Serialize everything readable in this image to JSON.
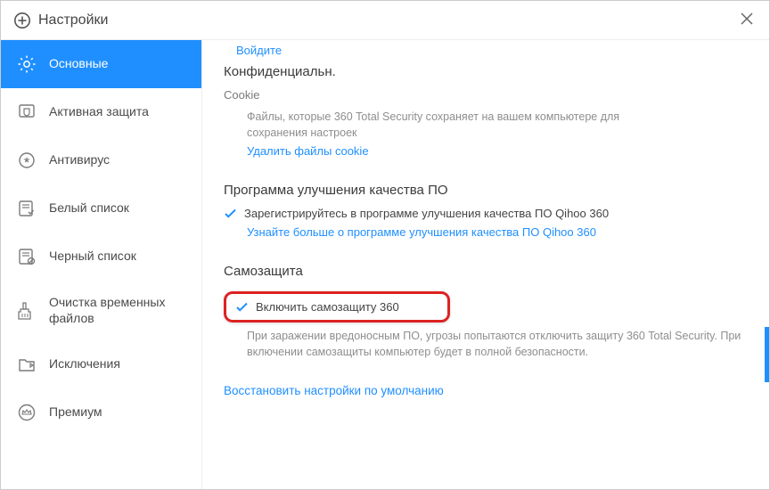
{
  "window": {
    "title": "Настройки"
  },
  "sidebar": {
    "items": [
      {
        "label": "Основные"
      },
      {
        "label": "Активная защита"
      },
      {
        "label": "Антивирус"
      },
      {
        "label": "Белый список"
      },
      {
        "label": "Черный список"
      },
      {
        "label": "Очистка временных файлов"
      },
      {
        "label": "Исключения"
      },
      {
        "label": "Премиум"
      }
    ]
  },
  "content": {
    "login_link": "Войдите",
    "privacy_heading": "Конфиденциальн.",
    "cookie_label": "Cookie",
    "cookie_desc": "Файлы, которые 360 Total Security сохраняет на вашем компьютере для сохранения настроек",
    "cookie_delete_link": "Удалить файлы cookie",
    "improvement_heading": "Программа улучшения качества ПО",
    "improvement_checkbox_label": "Зарегистрируйтесь в программе улучшения качества ПО Qihoo 360",
    "improvement_link": "Узнайте больше о программе улучшения качества ПО Qihoo 360",
    "selfprotect_heading": "Самозащита",
    "selfprotect_checkbox_label": "Включить самозащиту 360",
    "selfprotect_desc": "При заражении вредоносным ПО, угрозы попытаются отключить защиту 360 Total Security. При включении самозащиты компьютер будет в полной безопасности.",
    "restore_defaults_link": "Восстановить настройки по умолчанию"
  }
}
